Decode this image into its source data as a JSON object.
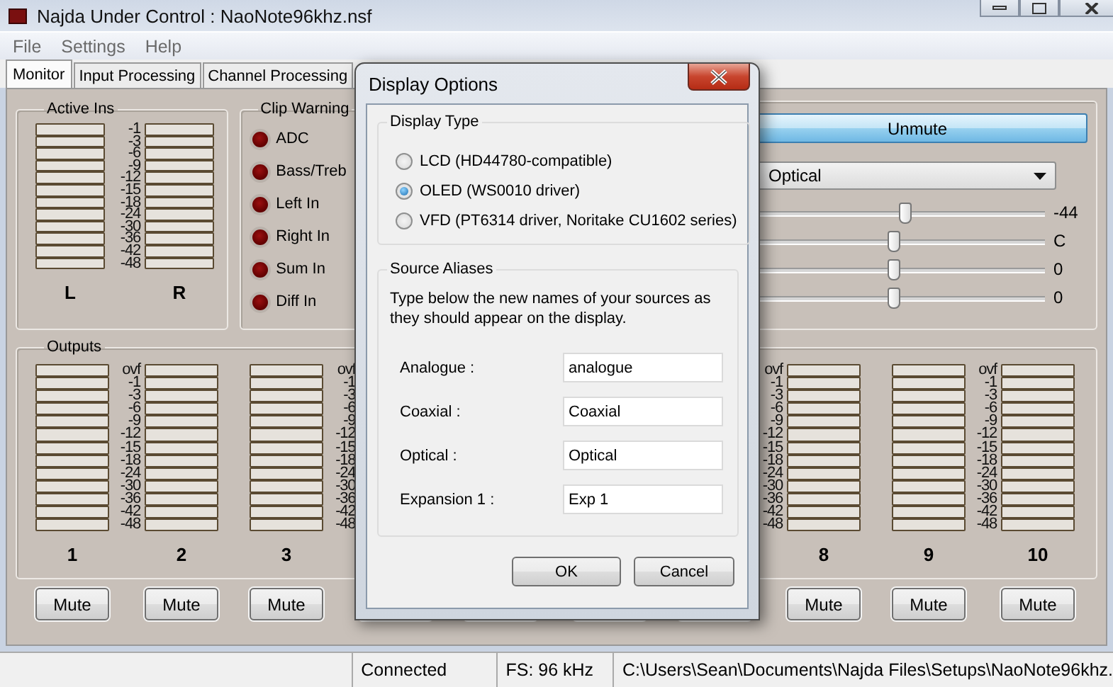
{
  "window": {
    "title": "Najda Under Control : NaoNote96khz.nsf"
  },
  "menu": [
    "File",
    "Settings",
    "Help"
  ],
  "tabs": [
    {
      "label": "Monitor",
      "selected": true
    },
    {
      "label": "Input Processing",
      "selected": false
    },
    {
      "label": "Channel Processing",
      "selected": false
    }
  ],
  "active_ins": {
    "title": "Active Ins",
    "meters": [
      {
        "label": "L"
      },
      {
        "label": "R"
      }
    ],
    "scale": [
      "-1",
      "-3",
      "-6",
      "-9",
      "-12",
      "-15",
      "-18",
      "-24",
      "-30",
      "-36",
      "-42",
      "-48"
    ]
  },
  "clip_warning": {
    "title": "Clip Warning",
    "indicators": [
      {
        "label": "ADC"
      },
      {
        "label": "Bass/Treb"
      },
      {
        "label": "Left In"
      },
      {
        "label": "Right In"
      },
      {
        "label": "Sum In"
      },
      {
        "label": "Diff In"
      }
    ]
  },
  "output_controls": {
    "button": "Unmute",
    "source": "Optical",
    "sliders": [
      {
        "level": 0.53,
        "reading": "-44"
      },
      {
        "level": 0.49,
        "reading": "C"
      },
      {
        "level": 0.49,
        "reading": "0"
      },
      {
        "level": 0.49,
        "reading": "0"
      }
    ]
  },
  "outputs": {
    "title": "Outputs",
    "pairs": [
      {
        "left": {
          "label": "1",
          "button": "Mute"
        },
        "scale": [
          "ovf",
          "-1",
          "-3",
          "-6",
          "-9",
          "-12",
          "-15",
          "-18",
          "-24",
          "-30",
          "-36",
          "-42",
          "-48"
        ],
        "right": {
          "label": "2",
          "button": "Mute"
        }
      },
      {
        "left": {
          "label": "3",
          "button": "Mute"
        },
        "scale": [
          "ovf",
          "-1",
          "-3",
          "-6",
          "-9",
          "-12",
          "-15",
          "-18",
          "-24",
          "-30",
          "-36",
          "-42",
          "-48"
        ]
      },
      {
        "scale": [
          "ovf",
          "-1",
          "-3",
          "-6",
          "-9",
          "-12",
          "-15",
          "-18",
          "-24",
          "-30",
          "-36",
          "-42",
          "-48"
        ],
        "right": {
          "label": "8",
          "button": "Mute"
        }
      },
      {
        "left": {
          "label": "9",
          "button": "Mute"
        },
        "scale": [
          "ovf",
          "-1",
          "-3",
          "-6",
          "-9",
          "-12",
          "-15",
          "-18",
          "-24",
          "-30",
          "-36",
          "-42",
          "-48"
        ],
        "right": {
          "label": "10",
          "button": "Mute"
        }
      }
    ]
  },
  "status_bar": [
    "Connected",
    "FS: 96 kHz",
    "C:\\Users\\Sean\\Documents\\Najda Files\\Setups\\NaoNote96khz."
  ],
  "dialog": {
    "title": "Display Options",
    "display_type": {
      "title": "Display Type",
      "options": [
        {
          "label": "LCD (HD44780-compatible)",
          "selected": false
        },
        {
          "label": "OLED (WS0010 driver)",
          "selected": true
        },
        {
          "label": "VFD (PT6314 driver, Noritake CU1602 series)",
          "selected": false
        }
      ]
    },
    "source_aliases": {
      "title": "Source Aliases",
      "description": "Type below the new names of your sources as they should appear on the display.",
      "fields": [
        {
          "label": "Analogue :",
          "value": "analogue"
        },
        {
          "label": "Coaxial :",
          "value": "Coaxial"
        },
        {
          "label": "Optical :",
          "value": "Optical"
        },
        {
          "label": "Expansion 1 :",
          "value": "Exp 1"
        }
      ]
    },
    "buttons": [
      "OK",
      "Cancel"
    ]
  }
}
